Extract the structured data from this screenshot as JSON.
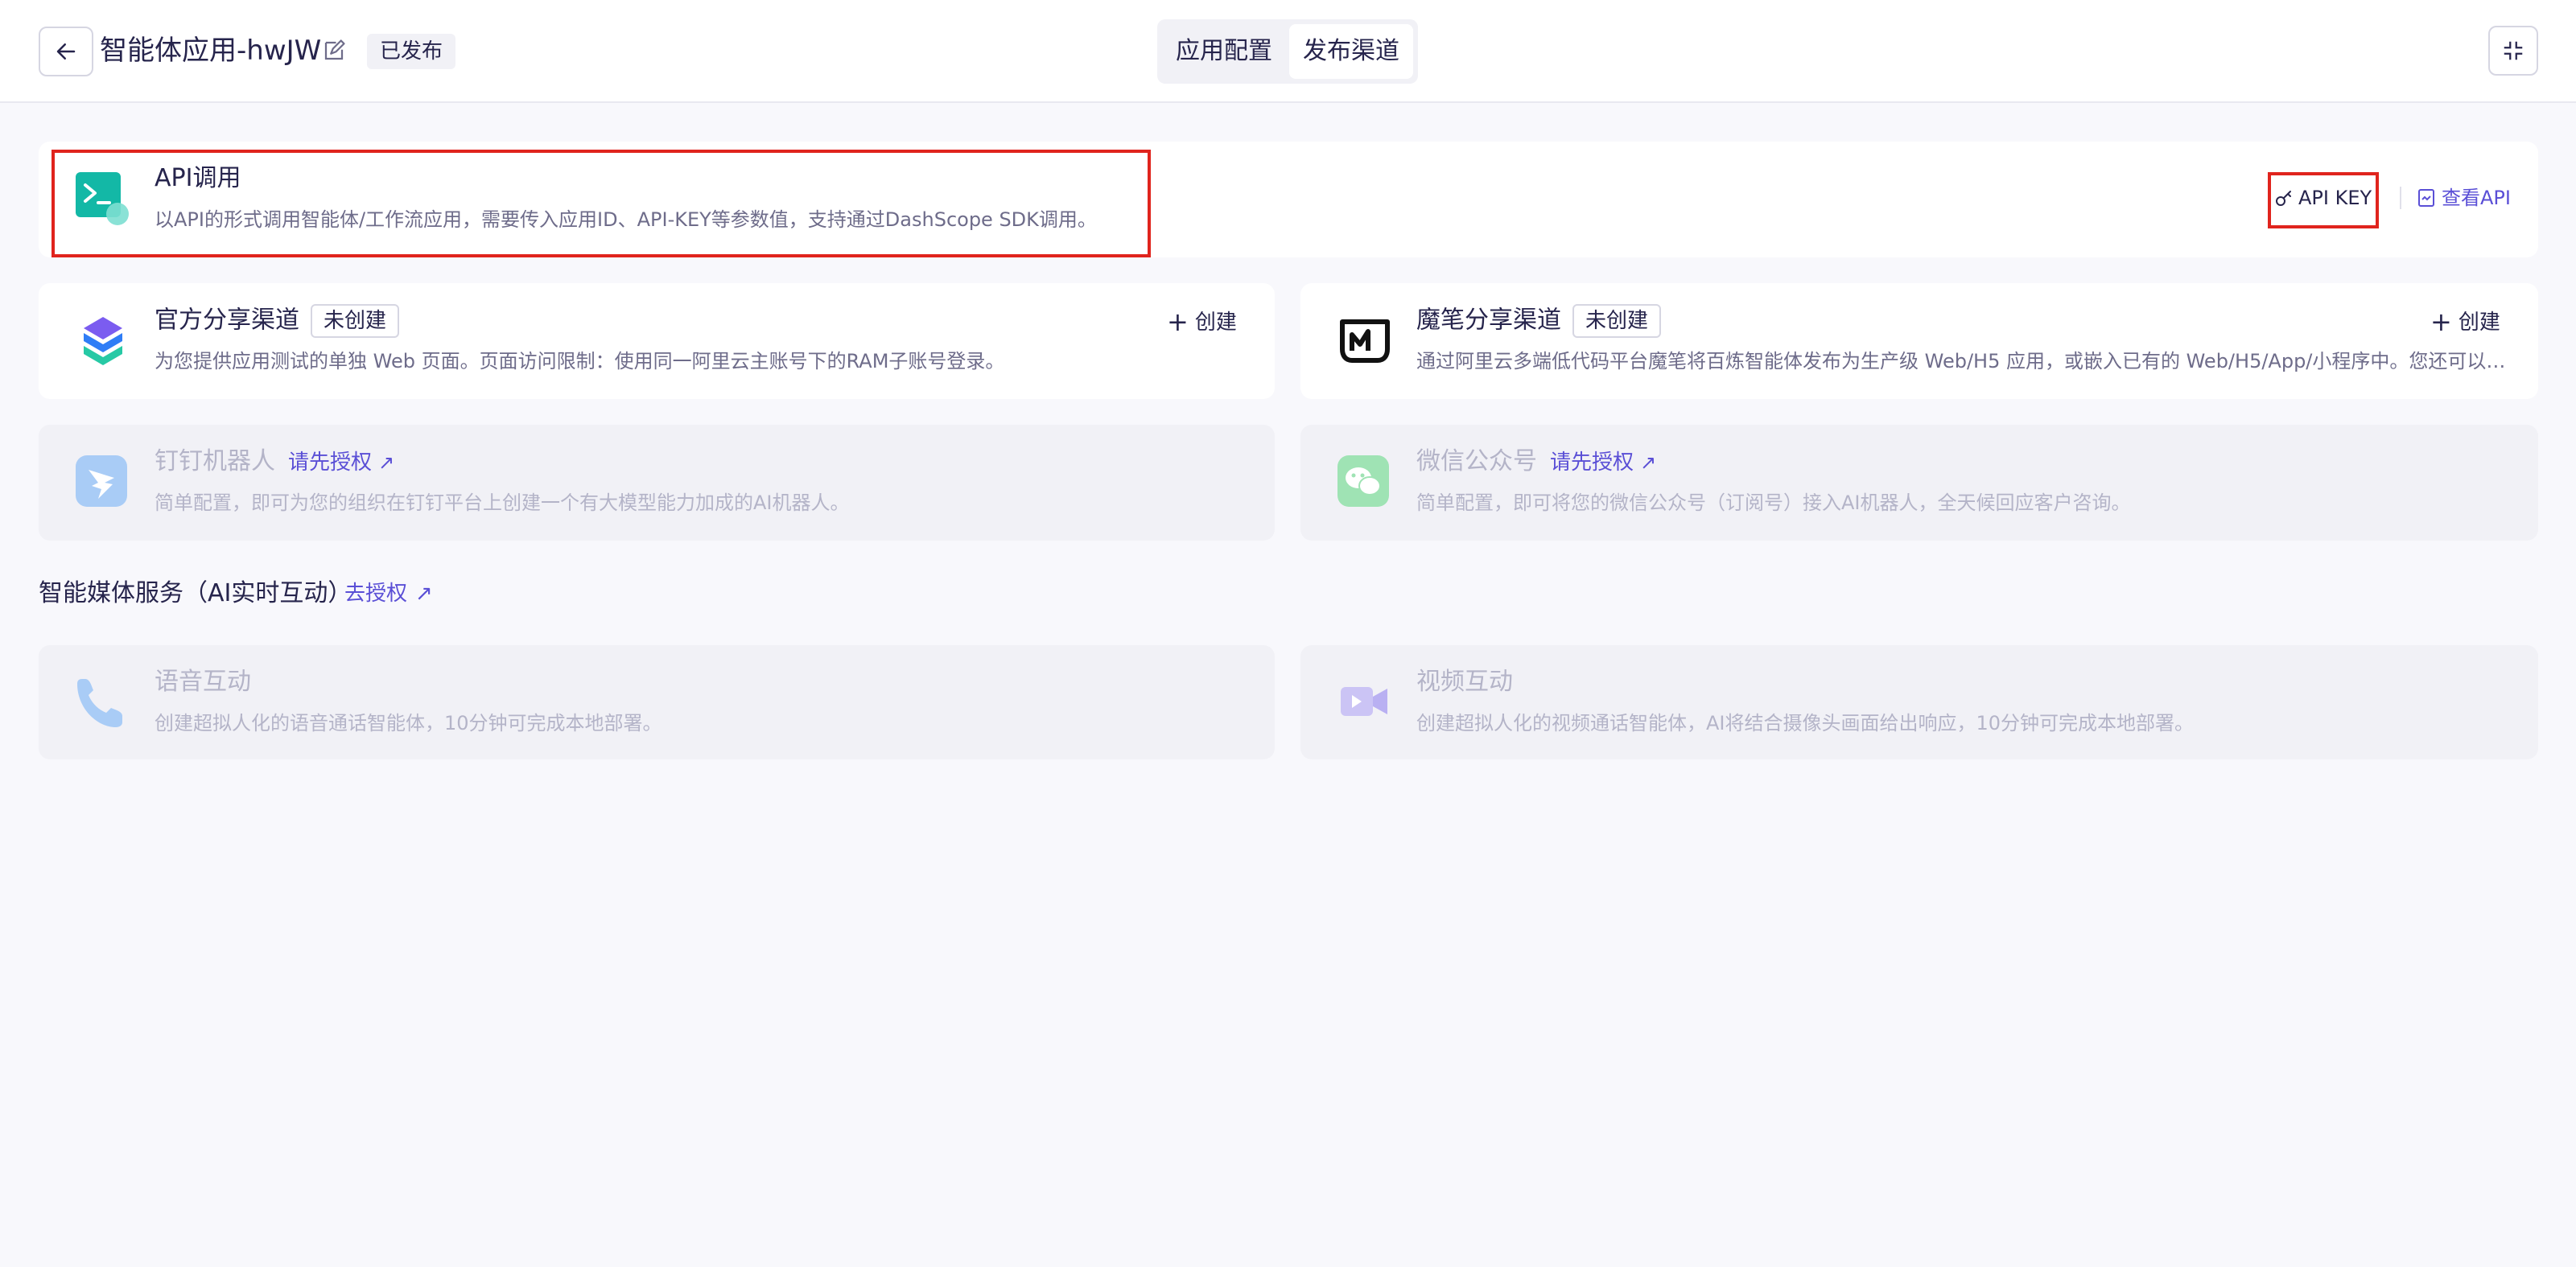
{
  "header": {
    "title": "智能体应用-hwJW",
    "status": "已发布",
    "tabs": [
      {
        "label": "应用配置",
        "active": false
      },
      {
        "label": "发布渠道",
        "active": true
      }
    ]
  },
  "api_card": {
    "title": "API调用",
    "description": "以API的形式调用智能体/工作流应用，需要传入应用ID、API-KEY等参数值，支持通过DashScope SDK调用。",
    "api_key_label": "API KEY",
    "view_api_label": "查看API"
  },
  "official_share": {
    "title": "官方分享渠道",
    "status": "未创建",
    "create_label": "创建",
    "description": "为您提供应用测试的单独 Web 页面。页面访问限制：使用同一阿里云主账号下的RAM子账号登录。"
  },
  "mobi_share": {
    "title": "魔笔分享渠道",
    "status": "未创建",
    "create_label": "创建",
    "description": "通过阿里云多端低代码平台魔笔将百炼智能体发布为生产级 Web/H5 应用，或嵌入已有的 Web/H5/App/小程序中。您还可以通..."
  },
  "dingtalk": {
    "title": "钉钉机器人",
    "auth_label": "请先授权",
    "description": "简单配置，即可为您的组织在钉钉平台上创建一个有大模型能力加成的AI机器人。"
  },
  "wechat": {
    "title": "微信公众号",
    "auth_label": "请先授权",
    "description": "简单配置，即可将您的微信公众号（订阅号）接入AI机器人，全天候回应客户咨询。"
  },
  "media_section": {
    "title": "智能媒体服务（AI实时互动）",
    "auth_label": "去授权"
  },
  "voice": {
    "title": "语音互动",
    "description": "创建超拟人化的语音通话智能体，10分钟可完成本地部署。"
  },
  "video": {
    "title": "视频互动",
    "description": "创建超拟人化的视频通话智能体，AI将结合摄像头画面给出响应，10分钟可完成本地部署。"
  },
  "icons": {
    "back": "arrow-left-icon",
    "edit": "edit-icon",
    "collapse": "collapse-icon",
    "api": "terminal-icon",
    "key": "key-icon",
    "doc": "document-icon",
    "official": "official-share-icon",
    "mobi": "mobi-logo-icon",
    "dingtalk": "dingtalk-icon",
    "wechat": "wechat-icon",
    "phone": "phone-icon",
    "video": "video-camera-icon"
  },
  "colors": {
    "accent": "#5a4fd6",
    "highlight_box": "#e0241d",
    "api_icon": "#13b8a6"
  }
}
